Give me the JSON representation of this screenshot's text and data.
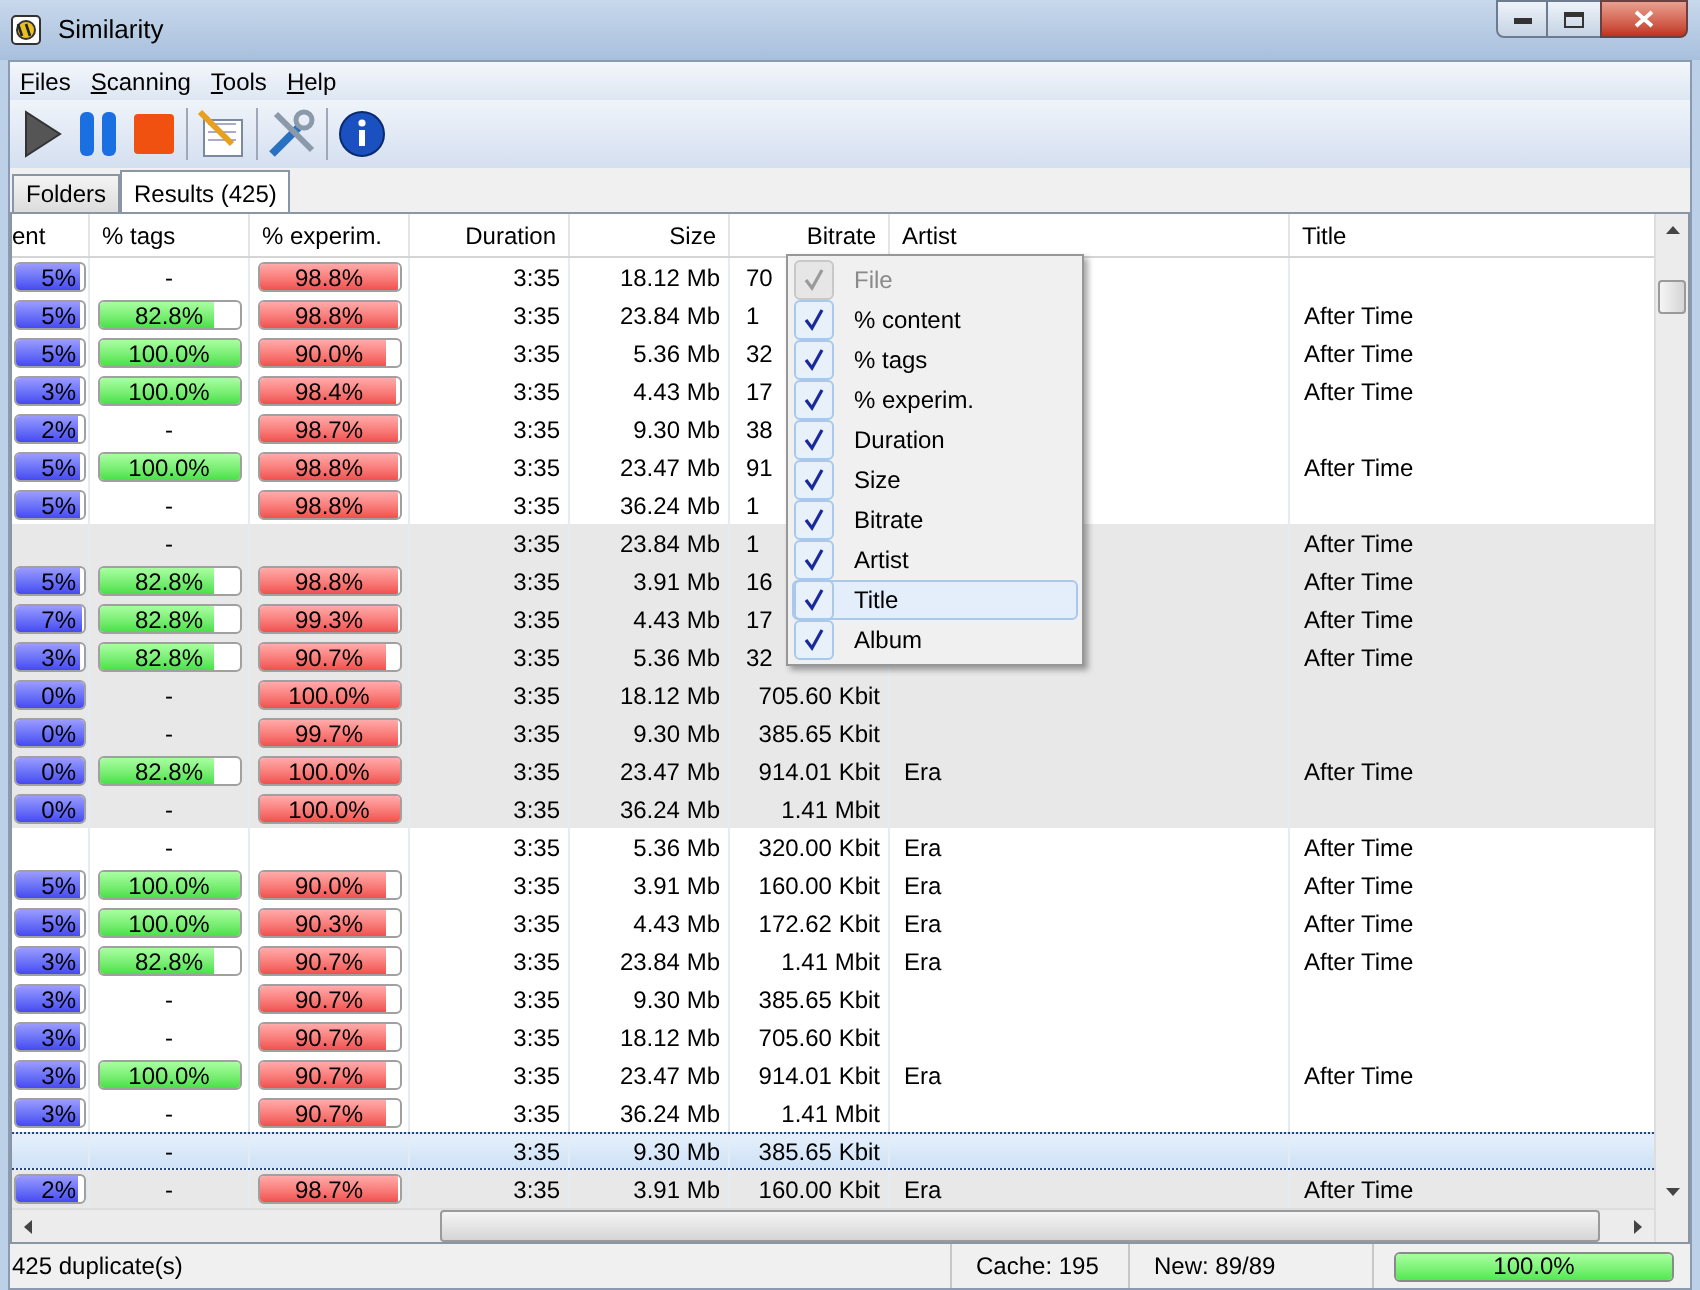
{
  "window": {
    "title": "Similarity"
  },
  "menu_bar": [
    "Files",
    "Scanning",
    "Tools",
    "Help"
  ],
  "tabs": [
    {
      "label": "Folders",
      "selected": false
    },
    {
      "label": "Results (425)",
      "selected": true
    }
  ],
  "table": {
    "columns": [
      "ent",
      "% tags",
      "% experim.",
      "Duration",
      "Size",
      "Bitrate",
      "Artist",
      "Title"
    ],
    "groups": [
      {
        "rows": [
          {
            "selected": false,
            "content": {
              "text": "5%",
              "level": 0.95
            },
            "tags": null,
            "experim": {
              "text": "98.8%",
              "level": 0.988
            },
            "duration": "3:35",
            "size": "18.12 Mb",
            "bitrate": "70",
            "artist": "",
            "title": ""
          },
          {
            "selected": false,
            "content": {
              "text": "5%",
              "level": 0.95
            },
            "tags": {
              "text": "82.8%",
              "level": 0.828
            },
            "experim": {
              "text": "98.8%",
              "level": 0.988
            },
            "duration": "3:35",
            "size": "23.84 Mb",
            "bitrate": "1",
            "artist": "",
            "title": "After Time"
          },
          {
            "selected": false,
            "content": {
              "text": "5%",
              "level": 0.95
            },
            "tags": {
              "text": "100.0%",
              "level": 1
            },
            "experim": {
              "text": "90.0%",
              "level": 0.9
            },
            "duration": "3:35",
            "size": "5.36 Mb",
            "bitrate": "32",
            "artist": "",
            "title": "After Time"
          },
          {
            "selected": false,
            "content": {
              "text": "3%",
              "level": 0.93
            },
            "tags": {
              "text": "100.0%",
              "level": 1
            },
            "experim": {
              "text": "98.4%",
              "level": 0.984
            },
            "duration": "3:35",
            "size": "4.43 Mb",
            "bitrate": "17",
            "artist": "",
            "title": "After Time"
          },
          {
            "selected": false,
            "content": {
              "text": "2%",
              "level": 0.92
            },
            "tags": null,
            "experim": {
              "text": "98.7%",
              "level": 0.987
            },
            "duration": "3:35",
            "size": "9.30 Mb",
            "bitrate": "38",
            "artist": "",
            "title": ""
          },
          {
            "selected": false,
            "content": {
              "text": "5%",
              "level": 0.95
            },
            "tags": {
              "text": "100.0%",
              "level": 1
            },
            "experim": {
              "text": "98.8%",
              "level": 0.988
            },
            "duration": "3:35",
            "size": "23.47 Mb",
            "bitrate": "91",
            "artist": "",
            "title": "After Time"
          },
          {
            "selected": false,
            "content": {
              "text": "5%",
              "level": 0.95
            },
            "tags": null,
            "experim": {
              "text": "98.8%",
              "level": 0.988
            },
            "duration": "3:35",
            "size": "36.24 Mb",
            "bitrate": "1",
            "artist": "",
            "title": ""
          }
        ]
      },
      {
        "rows": [
          {
            "selected": false,
            "content": null,
            "tags": null,
            "experim": null,
            "duration": "3:35",
            "size": "23.84 Mb",
            "bitrate": "1",
            "artist": "",
            "title": "After Time"
          },
          {
            "selected": false,
            "content": {
              "text": "5%",
              "level": 0.95
            },
            "tags": {
              "text": "82.8%",
              "level": 0.828
            },
            "experim": {
              "text": "98.8%",
              "level": 0.988
            },
            "duration": "3:35",
            "size": "3.91 Mb",
            "bitrate": "16",
            "artist": "",
            "title": "After Time"
          },
          {
            "selected": false,
            "content": {
              "text": "7%",
              "level": 0.97
            },
            "tags": {
              "text": "82.8%",
              "level": 0.828
            },
            "experim": {
              "text": "99.3%",
              "level": 0.993
            },
            "duration": "3:35",
            "size": "4.43 Mb",
            "bitrate": "17",
            "artist": "",
            "title": "After Time"
          },
          {
            "selected": false,
            "content": {
              "text": "3%",
              "level": 0.93
            },
            "tags": {
              "text": "82.8%",
              "level": 0.828
            },
            "experim": {
              "text": "90.7%",
              "level": 0.907
            },
            "duration": "3:35",
            "size": "5.36 Mb",
            "bitrate": "32",
            "artist": "",
            "title": "After Time"
          },
          {
            "selected": false,
            "content": {
              "text": "0%",
              "level": 1
            },
            "tags": null,
            "experim": {
              "text": "100.0%",
              "level": 1
            },
            "duration": "3:35",
            "size": "18.12 Mb",
            "bitrate": "705.60 Kbit",
            "artist": "",
            "title": ""
          },
          {
            "selected": false,
            "content": {
              "text": "0%",
              "level": 1
            },
            "tags": null,
            "experim": {
              "text": "99.7%",
              "level": 0.997
            },
            "duration": "3:35",
            "size": "9.30 Mb",
            "bitrate": "385.65 Kbit",
            "artist": "",
            "title": ""
          },
          {
            "selected": false,
            "content": {
              "text": "0%",
              "level": 1
            },
            "tags": {
              "text": "82.8%",
              "level": 0.828
            },
            "experim": {
              "text": "100.0%",
              "level": 1
            },
            "duration": "3:35",
            "size": "23.47 Mb",
            "bitrate": "914.01 Kbit",
            "artist": "Era",
            "title": "After Time"
          },
          {
            "selected": false,
            "content": {
              "text": "0%",
              "level": 1
            },
            "tags": null,
            "experim": {
              "text": "100.0%",
              "level": 1
            },
            "duration": "3:35",
            "size": "36.24 Mb",
            "bitrate": "1.41 Mbit",
            "artist": "",
            "title": ""
          }
        ]
      },
      {
        "rows": [
          {
            "selected": false,
            "content": null,
            "tags": null,
            "experim": null,
            "duration": "3:35",
            "size": "5.36 Mb",
            "bitrate": "320.00 Kbit",
            "artist": "Era",
            "title": "After Time"
          },
          {
            "selected": false,
            "content": {
              "text": "5%",
              "level": 0.95
            },
            "tags": {
              "text": "100.0%",
              "level": 1
            },
            "experim": {
              "text": "90.0%",
              "level": 0.9
            },
            "duration": "3:35",
            "size": "3.91 Mb",
            "bitrate": "160.00 Kbit",
            "artist": "Era",
            "title": "After Time"
          },
          {
            "selected": false,
            "content": {
              "text": "5%",
              "level": 0.95
            },
            "tags": {
              "text": "100.0%",
              "level": 1
            },
            "experim": {
              "text": "90.3%",
              "level": 0.903
            },
            "duration": "3:35",
            "size": "4.43 Mb",
            "bitrate": "172.62 Kbit",
            "artist": "Era",
            "title": "After Time"
          },
          {
            "selected": false,
            "content": {
              "text": "3%",
              "level": 0.93
            },
            "tags": {
              "text": "82.8%",
              "level": 0.828
            },
            "experim": {
              "text": "90.7%",
              "level": 0.907
            },
            "duration": "3:35",
            "size": "23.84 Mb",
            "bitrate": "1.41 Mbit",
            "artist": "Era",
            "title": "After Time"
          },
          {
            "selected": false,
            "content": {
              "text": "3%",
              "level": 0.93
            },
            "tags": null,
            "experim": {
              "text": "90.7%",
              "level": 0.907
            },
            "duration": "3:35",
            "size": "9.30 Mb",
            "bitrate": "385.65 Kbit",
            "artist": "",
            "title": ""
          },
          {
            "selected": false,
            "content": {
              "text": "3%",
              "level": 0.93
            },
            "tags": null,
            "experim": {
              "text": "90.7%",
              "level": 0.907
            },
            "duration": "3:35",
            "size": "18.12 Mb",
            "bitrate": "705.60 Kbit",
            "artist": "",
            "title": ""
          },
          {
            "selected": false,
            "content": {
              "text": "3%",
              "level": 0.93
            },
            "tags": {
              "text": "100.0%",
              "level": 1
            },
            "experim": {
              "text": "90.7%",
              "level": 0.907
            },
            "duration": "3:35",
            "size": "23.47 Mb",
            "bitrate": "914.01 Kbit",
            "artist": "Era",
            "title": "After Time"
          },
          {
            "selected": false,
            "content": {
              "text": "3%",
              "level": 0.93
            },
            "tags": null,
            "experim": {
              "text": "90.7%",
              "level": 0.907
            },
            "duration": "3:35",
            "size": "36.24 Mb",
            "bitrate": "1.41 Mbit",
            "artist": "",
            "title": ""
          }
        ]
      },
      {
        "rows": [
          {
            "selected": true,
            "content": null,
            "tags": null,
            "experim": null,
            "duration": "3:35",
            "size": "9.30 Mb",
            "bitrate": "385.65 Kbit",
            "artist": "",
            "title": ""
          },
          {
            "selected": false,
            "content": {
              "text": "2%",
              "level": 0.92
            },
            "tags": null,
            "experim": {
              "text": "98.7%",
              "level": 0.987
            },
            "duration": "3:35",
            "size": "3.91 Mb",
            "bitrate": "160.00 Kbit",
            "artist": "Era",
            "title": "After Time"
          }
        ]
      }
    ],
    "empty_mark": "-"
  },
  "column_menu": {
    "items": [
      {
        "label": "File",
        "checked": true,
        "disabled": true,
        "highlighted": false
      },
      {
        "label": "% content",
        "checked": true,
        "disabled": false,
        "highlighted": false
      },
      {
        "label": "% tags",
        "checked": true,
        "disabled": false,
        "highlighted": false
      },
      {
        "label": "% experim.",
        "checked": true,
        "disabled": false,
        "highlighted": false
      },
      {
        "label": "Duration",
        "checked": true,
        "disabled": false,
        "highlighted": false
      },
      {
        "label": "Size",
        "checked": true,
        "disabled": false,
        "highlighted": false
      },
      {
        "label": "Bitrate",
        "checked": true,
        "disabled": false,
        "highlighted": false
      },
      {
        "label": "Artist",
        "checked": true,
        "disabled": false,
        "highlighted": false
      },
      {
        "label": "Title",
        "checked": true,
        "disabled": false,
        "highlighted": true
      },
      {
        "label": "Album",
        "checked": true,
        "disabled": false,
        "highlighted": false
      }
    ]
  },
  "status_bar": {
    "duplicates": "425 duplicate(s)",
    "cache": "Cache: 195",
    "new": "New: 89/89",
    "progress": {
      "text": "100.0%",
      "level": 1
    }
  }
}
